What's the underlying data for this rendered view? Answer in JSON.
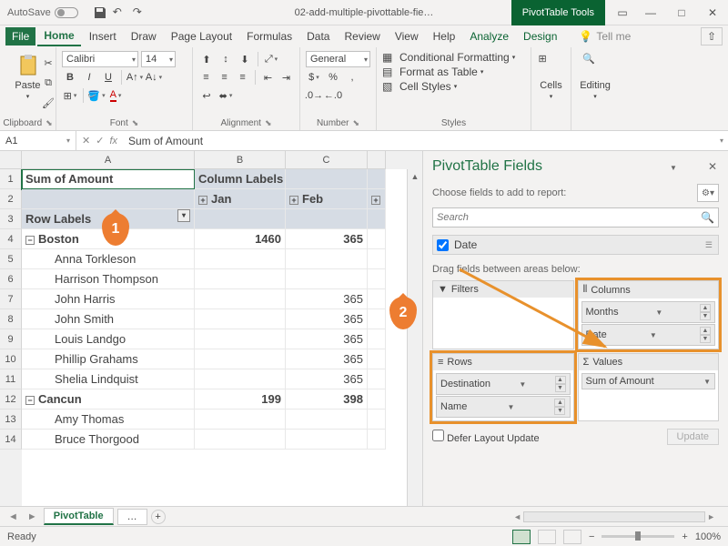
{
  "titlebar": {
    "autosave": "AutoSave",
    "doc_title": "02-add-multiple-pivottable-fie…",
    "contextual_title": "PivotTable Tools"
  },
  "tabs": {
    "file": "File",
    "home": "Home",
    "insert": "Insert",
    "draw": "Draw",
    "page_layout": "Page Layout",
    "formulas": "Formulas",
    "data": "Data",
    "review": "Review",
    "view": "View",
    "help": "Help",
    "analyze": "Analyze",
    "design": "Design",
    "tell_me": "Tell me"
  },
  "ribbon": {
    "clipboard": {
      "label": "Clipboard",
      "paste": "Paste"
    },
    "font": {
      "label": "Font",
      "family": "Calibri",
      "size": "14"
    },
    "alignment": {
      "label": "Alignment"
    },
    "number": {
      "label": "Number",
      "format": "General"
    },
    "styles": {
      "label": "Styles",
      "cond": "Conditional Formatting",
      "table": "Format as Table",
      "cell": "Cell Styles"
    },
    "cells": {
      "label": "Cells"
    },
    "editing": {
      "label": "Editing"
    }
  },
  "namebox": "A1",
  "formula": "Sum of Amount",
  "pivot": {
    "col_labels": "Column Labels",
    "row_labels": "Row Labels",
    "months": [
      "Jan",
      "Feb"
    ],
    "a1": "Sum of Amount",
    "rows": [
      {
        "type": "dest",
        "label": "Boston",
        "jan": "1460",
        "feb": "365"
      },
      {
        "type": "name",
        "label": "Anna Torkleson"
      },
      {
        "type": "name",
        "label": "Harrison Thompson"
      },
      {
        "type": "name",
        "label": "John Harris",
        "feb": "365"
      },
      {
        "type": "name",
        "label": "John Smith",
        "feb": "365"
      },
      {
        "type": "name",
        "label": "Louis Landgo",
        "feb": "365"
      },
      {
        "type": "name",
        "label": "Phillip Grahams",
        "jan": "",
        "feb": "365"
      },
      {
        "type": "name",
        "label": "Shelia Lindquist",
        "feb": "365"
      },
      {
        "type": "dest",
        "label": "Cancun",
        "jan": "199",
        "feb": "398"
      },
      {
        "type": "name",
        "label": "Amy Thomas"
      },
      {
        "type": "name",
        "label": "Bruce Thorgood"
      }
    ]
  },
  "pane": {
    "title": "PivotTable Fields",
    "choose": "Choose fields to add to report:",
    "search": "Search",
    "field_date": "Date",
    "drag": "Drag fields between areas below:",
    "filters": "Filters",
    "columns": "Columns",
    "col_items": [
      "Months",
      "Date"
    ],
    "rows": "Rows",
    "row_items": [
      "Destination",
      "Name"
    ],
    "values": "Values",
    "val_items": [
      "Sum of Amount"
    ],
    "defer": "Defer Layout Update",
    "update": "Update"
  },
  "sheet_tabs": {
    "active": "PivotTable",
    "more": "…"
  },
  "status": {
    "ready": "Ready",
    "zoom": "100%"
  }
}
